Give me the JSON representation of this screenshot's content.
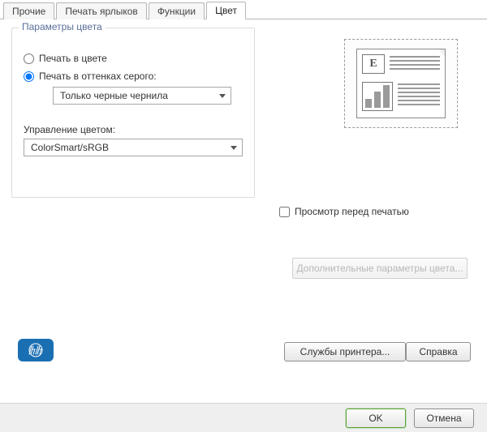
{
  "tabs": {
    "other": "Прочие",
    "labels": "Печать ярлыков",
    "functions": "Функции",
    "color": "Цвет"
  },
  "color_options": {
    "group_title": "Параметры цвета",
    "print_color": "Печать в цвете",
    "print_gray": "Печать в оттенках серого:",
    "gray_mode_selected": "Только черные чернила",
    "color_mgmt_label": "Управление цветом:",
    "color_mgmt_selected": "ColorSmart/sRGB"
  },
  "preview": {
    "checkbox_label": "Просмотр перед печатью",
    "advanced_button": "Дополнительные параметры цвета..."
  },
  "bottom": {
    "services": "Службы принтера...",
    "help": "Справка"
  },
  "footer": {
    "ok": "OK",
    "cancel": "Отмена"
  }
}
